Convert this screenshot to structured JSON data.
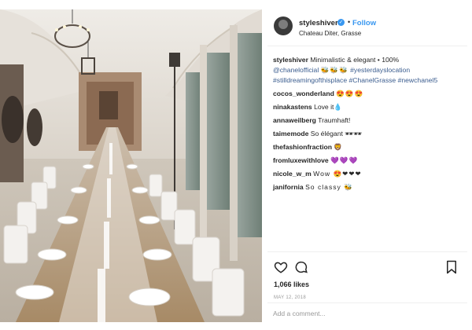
{
  "post": {
    "username": "styleshiver",
    "verified_icon": "verified-badge-icon",
    "follow_label": "Follow",
    "location": "Chateau Diter, Grasse",
    "caption": {
      "username": "styleshiver",
      "text": "Minimalistic & elegant • 100%",
      "mention": "@chanelofficial",
      "emoji": "🐝🐝🐝",
      "hashtags": "#yesterdayslocation #stilldreamingofthisplace #ChanelGrasse #newchanel5"
    },
    "comments": [
      {
        "user": "cocos_wonderland",
        "text": "😍😍😍"
      },
      {
        "user": "ninakastens",
        "text": "Love it💧"
      },
      {
        "user": "annaweilberg",
        "text": "Traumhaft!"
      },
      {
        "user": "taimemode",
        "text": "So élégant 🕶🕶"
      },
      {
        "user": "thefashionfraction",
        "text": "🦁"
      },
      {
        "user": "fromluxewithlove",
        "text": "💜💜💜"
      },
      {
        "user": "nicole_w_m",
        "text": "Wow 😍❤❤❤"
      },
      {
        "user": "janifornia",
        "text": "So classy 🐝"
      }
    ],
    "likes": "1,066 likes",
    "date": "MAY 12, 2018",
    "add_comment_placeholder": "Add a comment..."
  },
  "colors": {
    "link": "#3897f0",
    "hashtag": "#3b5d8f",
    "text": "#262626"
  }
}
